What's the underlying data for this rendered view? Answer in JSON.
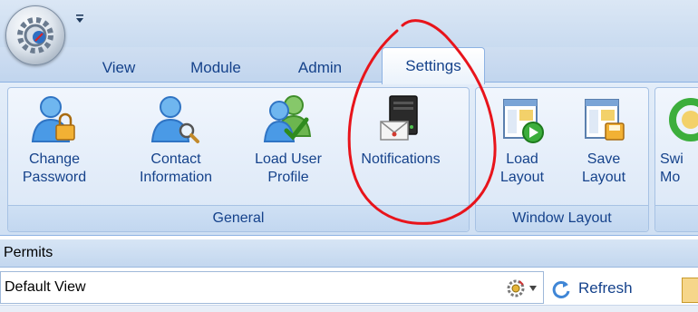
{
  "tabs": [
    {
      "label": "View"
    },
    {
      "label": "Module"
    },
    {
      "label": "Admin"
    },
    {
      "label": "Settings",
      "active": true
    }
  ],
  "ribbon": {
    "groups": [
      {
        "caption": "General",
        "buttons": [
          {
            "label": "Change\nPassword",
            "icon": "user-lock-icon"
          },
          {
            "label": "Contact\nInformation",
            "icon": "user-search-icon"
          },
          {
            "label": "Load User\nProfile",
            "icon": "users-check-icon"
          },
          {
            "label": "Notifications",
            "icon": "mail-server-icon"
          }
        ]
      },
      {
        "caption": "Window Layout",
        "buttons": [
          {
            "label": "Load\nLayout",
            "icon": "layout-load-icon"
          },
          {
            "label": "Save\nLayout",
            "icon": "layout-save-icon"
          }
        ]
      },
      {
        "caption": "",
        "buttons": [
          {
            "label": "Swi\nMo",
            "icon": "switch-mode-icon"
          }
        ]
      }
    ]
  },
  "section": {
    "title": "Permits"
  },
  "view_select": {
    "value": "Default View"
  },
  "toolbar": {
    "refresh_label": "Refresh"
  },
  "colors": {
    "annotation": "#e8141b",
    "ribbon_text": "#15428b",
    "accent_blue": "#3f86d6"
  }
}
